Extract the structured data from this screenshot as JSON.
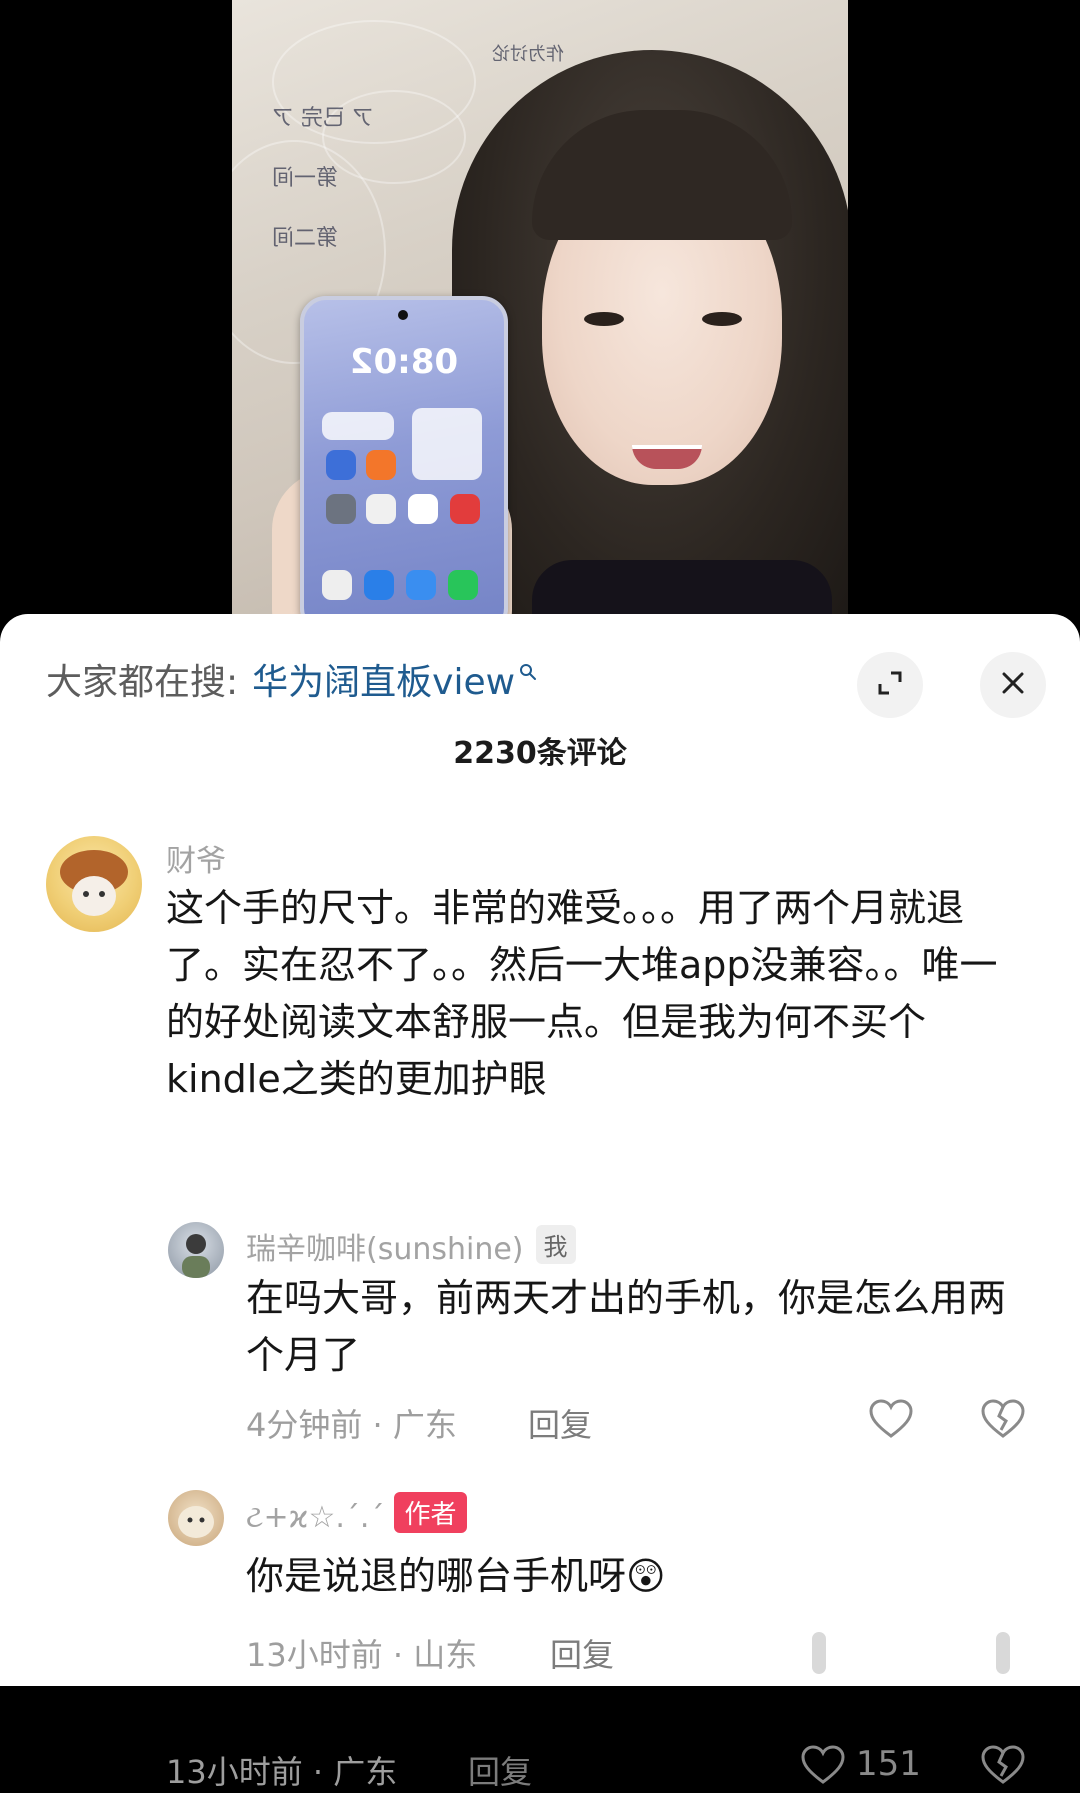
{
  "search": {
    "prefix": "大家都在搜:",
    "term": "华为阔直板view"
  },
  "header": {
    "comment_count": "2230条评论"
  },
  "video": {
    "phone_clock": "08:02"
  },
  "comments": [
    {
      "username": "财爷",
      "text": "这个手的尺寸。非常的难受。。。用了两个月就退了。实在忍不了。。然后一大堆app没兼容。。唯一的好处阅读文本舒服一点。但是我为何不买个kindle之类的更加护眼",
      "time_location": "13小时前 · 广东",
      "reply": "回复",
      "likes": "151"
    }
  ],
  "replies": [
    {
      "username": "瑞辛咖啡(sunshine)",
      "badge": "我",
      "text": "在吗大哥，前两天才出的手机，你是怎么用两个月了",
      "time_location": "4分钟前 · 广东",
      "reply": "回复"
    },
    {
      "username": "ટ+ϰ☆.ˊ.ˊ",
      "badge": "作者",
      "text": "你是说退的哪台手机呀😲",
      "time_location": "13小时前 · 山东",
      "reply": "回复"
    }
  ],
  "colors": {
    "search_term": "#1f5b8f",
    "author_badge": "#f0405e"
  }
}
